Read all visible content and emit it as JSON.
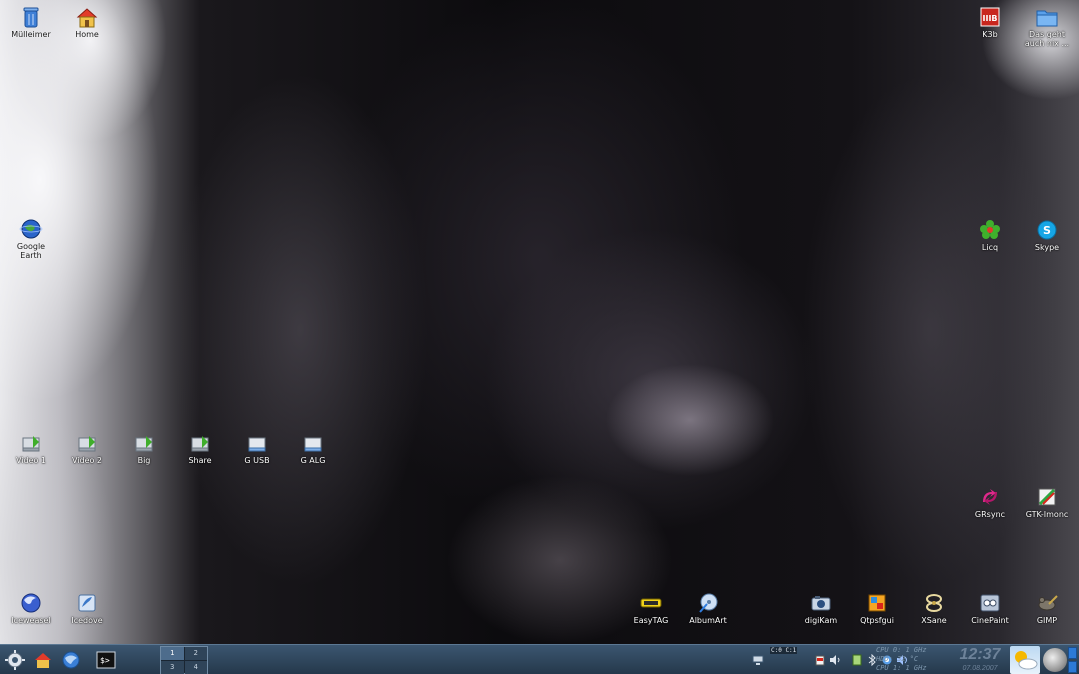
{
  "desktop": {
    "icons": [
      {
        "id": "trash",
        "label": "Mülleimer",
        "icon": "trash-icon"
      },
      {
        "id": "home",
        "label": "Home",
        "icon": "home-folder-icon"
      },
      {
        "id": "k3b",
        "label": "K3b",
        "icon": "k3b-icon"
      },
      {
        "id": "folder",
        "label": "Das geht\nauch nix ...",
        "icon": "folder-icon"
      },
      {
        "id": "google-earth",
        "label": "Google\nEarth",
        "icon": "google-earth-icon"
      },
      {
        "id": "licq",
        "label": "Licq",
        "icon": "licq-flower-icon"
      },
      {
        "id": "skype",
        "label": "Skype",
        "icon": "skype-icon"
      },
      {
        "id": "video1",
        "label": "Video 1",
        "icon": "network-drive-icon"
      },
      {
        "id": "video2",
        "label": "Video 2",
        "icon": "network-drive-icon"
      },
      {
        "id": "big",
        "label": "Big",
        "icon": "network-drive-icon"
      },
      {
        "id": "share",
        "label": "Share",
        "icon": "network-drive-icon"
      },
      {
        "id": "gusb",
        "label": "G USB",
        "icon": "drive-icon"
      },
      {
        "id": "galg",
        "label": "G ALG",
        "icon": "drive-icon"
      },
      {
        "id": "grsync",
        "label": "GRsync",
        "icon": "grsync-icon"
      },
      {
        "id": "gtkimonc",
        "label": "GTK-Imonc",
        "icon": "gtkimonc-icon"
      },
      {
        "id": "iceweasel",
        "label": "Iceweasel",
        "icon": "iceweasel-icon"
      },
      {
        "id": "icedove",
        "label": "Icedove",
        "icon": "icedove-icon"
      },
      {
        "id": "easytag",
        "label": "EasyTAG",
        "icon": "easytag-icon"
      },
      {
        "id": "albumart",
        "label": "AlbumArt",
        "icon": "albumart-icon"
      },
      {
        "id": "digikam",
        "label": "digiKam",
        "icon": "digikam-icon"
      },
      {
        "id": "qtpsfgui",
        "label": "Qtpsfgui",
        "icon": "qtpsfgui-icon"
      },
      {
        "id": "xsane",
        "label": "XSane",
        "icon": "xsane-icon"
      },
      {
        "id": "cinepaint",
        "label": "CinePaint",
        "icon": "cinepaint-icon"
      },
      {
        "id": "gimp",
        "label": "GIMP",
        "icon": "gimp-icon"
      }
    ]
  },
  "taskbar": {
    "launchers": [
      {
        "name": "kde-menu-icon"
      },
      {
        "name": "home-icon"
      },
      {
        "name": "browser-globe-icon"
      },
      {
        "name": "terminal-icon"
      }
    ],
    "pager": [
      "1",
      "2",
      "3",
      "4"
    ],
    "active_desktop": "1",
    "tray_cpu": "C:0 C:1",
    "sysmon": [
      "CPU 0: 1 GHz",
      "HDD: 32 °C",
      "CPU 1: 1 GHz"
    ],
    "clock": {
      "time": "12:37",
      "date": "07.08.2007"
    }
  },
  "colors": {
    "taskbar_top": "#3b5670",
    "taskbar_bottom": "#25384b",
    "accent": "#2d7ad6"
  }
}
